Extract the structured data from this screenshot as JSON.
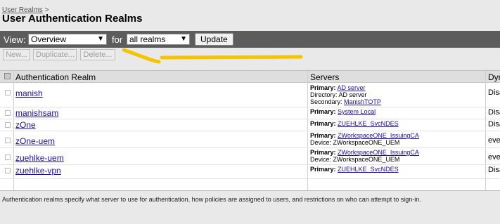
{
  "breadcrumb": {
    "link": "User Realms",
    "separator": ">"
  },
  "page_title": "User Authentication Realms",
  "view_bar": {
    "view_label": "View:",
    "view_select": "Overview",
    "for_label": "for",
    "for_select": "all realms",
    "update_button": "Update"
  },
  "toolbar": {
    "new": "New...",
    "duplicate": "Duplicate...",
    "delete": "Delete..."
  },
  "annotation": {
    "color": "#f5c400"
  },
  "table": {
    "columns": {
      "realm": "Authentication Realm",
      "servers": "Servers",
      "dyn": "Dyr"
    },
    "rows": [
      {
        "name": "manish",
        "servers": [
          {
            "label": "Primary:",
            "value": "AD server",
            "link": true,
            "bold": true
          },
          {
            "label": "Directory:",
            "value": "AD server",
            "link": false,
            "bold": false
          },
          {
            "label": "Secondary:",
            "value": "ManishTOTP",
            "link": true,
            "bold": false
          }
        ],
        "dyn": "Disa"
      },
      {
        "name": "manishsam",
        "servers": [
          {
            "label": "Primary:",
            "value": "System Local",
            "link": true,
            "bold": true
          }
        ],
        "dyn": "Disa"
      },
      {
        "name": "zOne",
        "servers": [
          {
            "label": "Primary:",
            "value": "ZUEHLKE_SvcNDES",
            "link": true,
            "bold": true
          }
        ],
        "dyn": "Disa"
      },
      {
        "name": "zOne-uem",
        "servers": [
          {
            "label": "Primary:",
            "value": "ZWorkspaceONE_IssuingCA",
            "link": true,
            "bold": true
          },
          {
            "label": "Device:",
            "value": "ZWorkspaceONE_UEM",
            "link": false,
            "bold": false
          }
        ],
        "dyn": "eve"
      },
      {
        "name": "zuehlke-uem",
        "servers": [
          {
            "label": "Primary:",
            "value": "ZWorkspaceONE_IssuingCA",
            "link": true,
            "bold": true
          },
          {
            "label": "Device:",
            "value": "ZWorkspaceONE_UEM",
            "link": false,
            "bold": false
          }
        ],
        "dyn": "eve"
      },
      {
        "name": "zuehlke-vpn",
        "servers": [
          {
            "label": "Primary:",
            "value": "ZUEHLKE_SvcNDES",
            "link": true,
            "bold": true
          }
        ],
        "dyn": "Disa"
      }
    ]
  },
  "footer": "Authentication realms specify what server to use for authentication, how policies are assigned to users, and restrictions on who can attempt to sign-in."
}
